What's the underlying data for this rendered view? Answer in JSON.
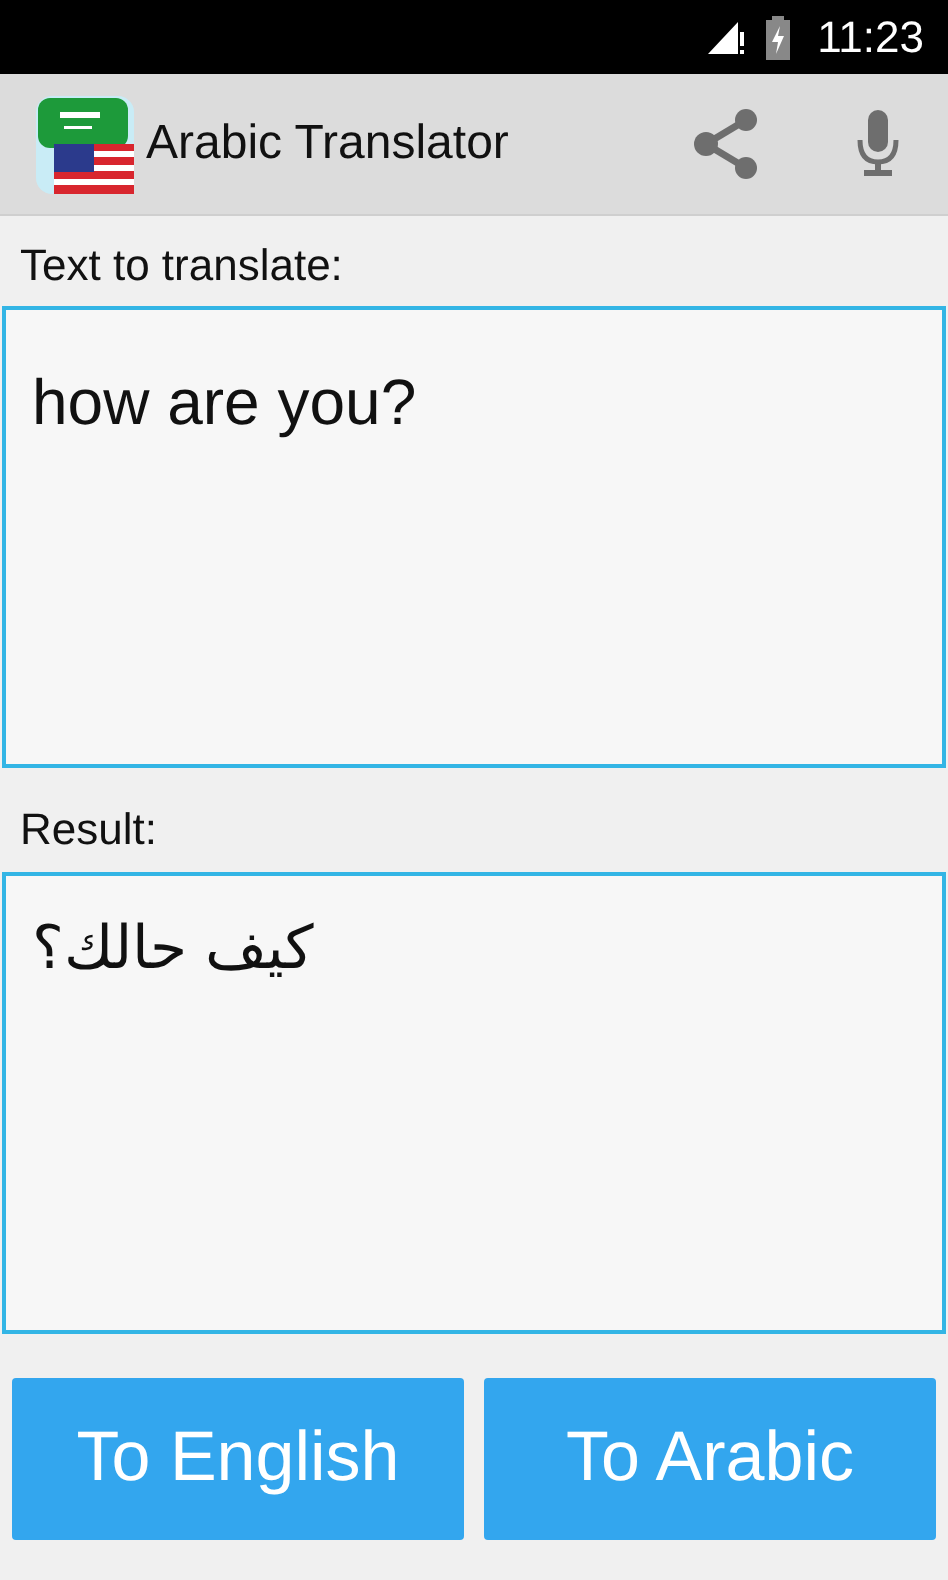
{
  "status_bar": {
    "time": "11:23"
  },
  "app_bar": {
    "title": "Arabic Translator"
  },
  "input": {
    "label": "Text to translate:",
    "value": "how are you?"
  },
  "result": {
    "label": "Result:",
    "value": "كيف حالك؟"
  },
  "buttons": [
    {
      "label": "To English"
    },
    {
      "label": "To Arabic"
    }
  ]
}
